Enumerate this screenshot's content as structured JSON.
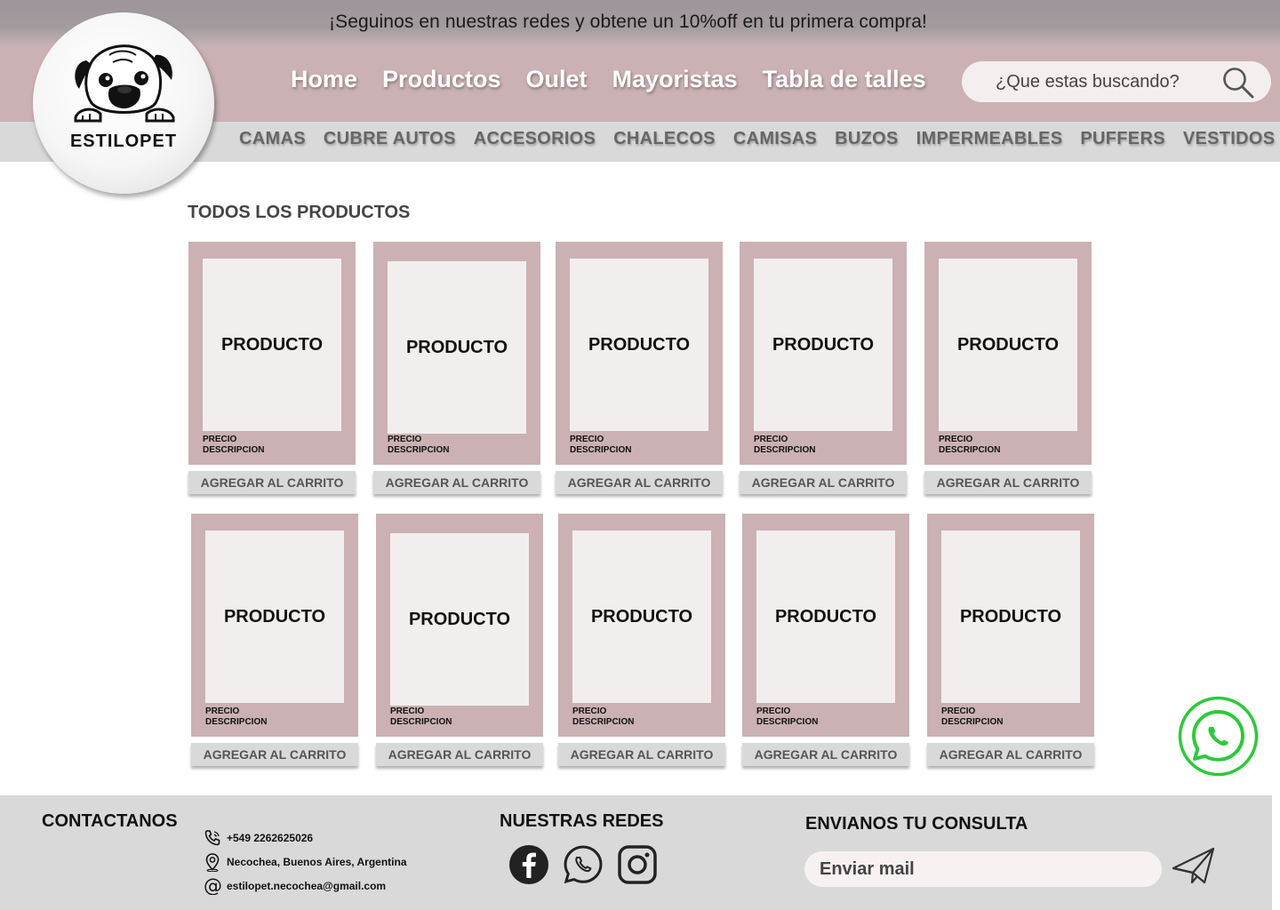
{
  "promo": {
    "text": "¡Seguinos en nuestras redes y obtene un 10%off en tu primera compra!"
  },
  "logo": {
    "text": "ESTILOPET"
  },
  "nav": {
    "links": [
      "Home",
      "Productos",
      "Oulet",
      "Mayoristas",
      "Tabla de talles"
    ]
  },
  "search": {
    "placeholder": "¿Que estas buscando?",
    "icon": "search-icon"
  },
  "categories": [
    "CAMAS",
    "CUBRE AUTOS",
    "ACCESORIOS",
    "CHALECOS",
    "CAMISAS",
    "BUZOS",
    "IMPERMEABLES",
    "PUFFERS",
    "VESTIDOS"
  ],
  "main": {
    "title": "TODOS LOS PRODUCTOS",
    "products": [
      {
        "name": "PRODUCTO",
        "price": "PRECIO",
        "description": "DESCRIPCION",
        "button": "AGREGAR AL CARRITO"
      },
      {
        "name": "PRODUCTO",
        "price": "PRECIO",
        "description": "DESCRIPCION",
        "button": "AGREGAR AL CARRITO"
      },
      {
        "name": "PRODUCTO",
        "price": "PRECIO",
        "description": "DESCRIPCION",
        "button": "AGREGAR AL CARRITO"
      },
      {
        "name": "PRODUCTO",
        "price": "PRECIO",
        "description": "DESCRIPCION",
        "button": "AGREGAR AL CARRITO"
      },
      {
        "name": "PRODUCTO",
        "price": "PRECIO",
        "description": "DESCRIPCION",
        "button": "AGREGAR AL CARRITO"
      },
      {
        "name": "PRODUCTO",
        "price": "PRECIO",
        "description": "DESCRIPCION",
        "button": "AGREGAR AL CARRITO"
      },
      {
        "name": "PRODUCTO",
        "price": "PRECIO",
        "description": "DESCRIPCION",
        "button": "AGREGAR AL CARRITO"
      },
      {
        "name": "PRODUCTO",
        "price": "PRECIO",
        "description": "DESCRIPCION",
        "button": "AGREGAR AL CARRITO"
      },
      {
        "name": "PRODUCTO",
        "price": "PRECIO",
        "description": "DESCRIPCION",
        "button": "AGREGAR AL CARRITO"
      },
      {
        "name": "PRODUCTO",
        "price": "PRECIO",
        "description": "DESCRIPCION",
        "button": "AGREGAR AL CARRITO"
      }
    ]
  },
  "footer": {
    "contact_title": "CONTACTANOS",
    "phone": "+549 2262625026",
    "address": "Necochea, Buenos Aires, Argentina",
    "email": "estilopet.necochea@gmail.com",
    "social_title": "NUESTRAS REDES",
    "social_icons": [
      "facebook-icon",
      "whatsapp-icon",
      "instagram-icon"
    ],
    "inquiry_title": "ENVIANOS TU CONSULTA",
    "mail_placeholder": "Enviar mail"
  },
  "colors": {
    "brand_pink": "#cbb1b4",
    "card_inner": "#f3eeee",
    "gray_bar": "#d9d9d9",
    "whatsapp_green": "#2ec83c"
  }
}
